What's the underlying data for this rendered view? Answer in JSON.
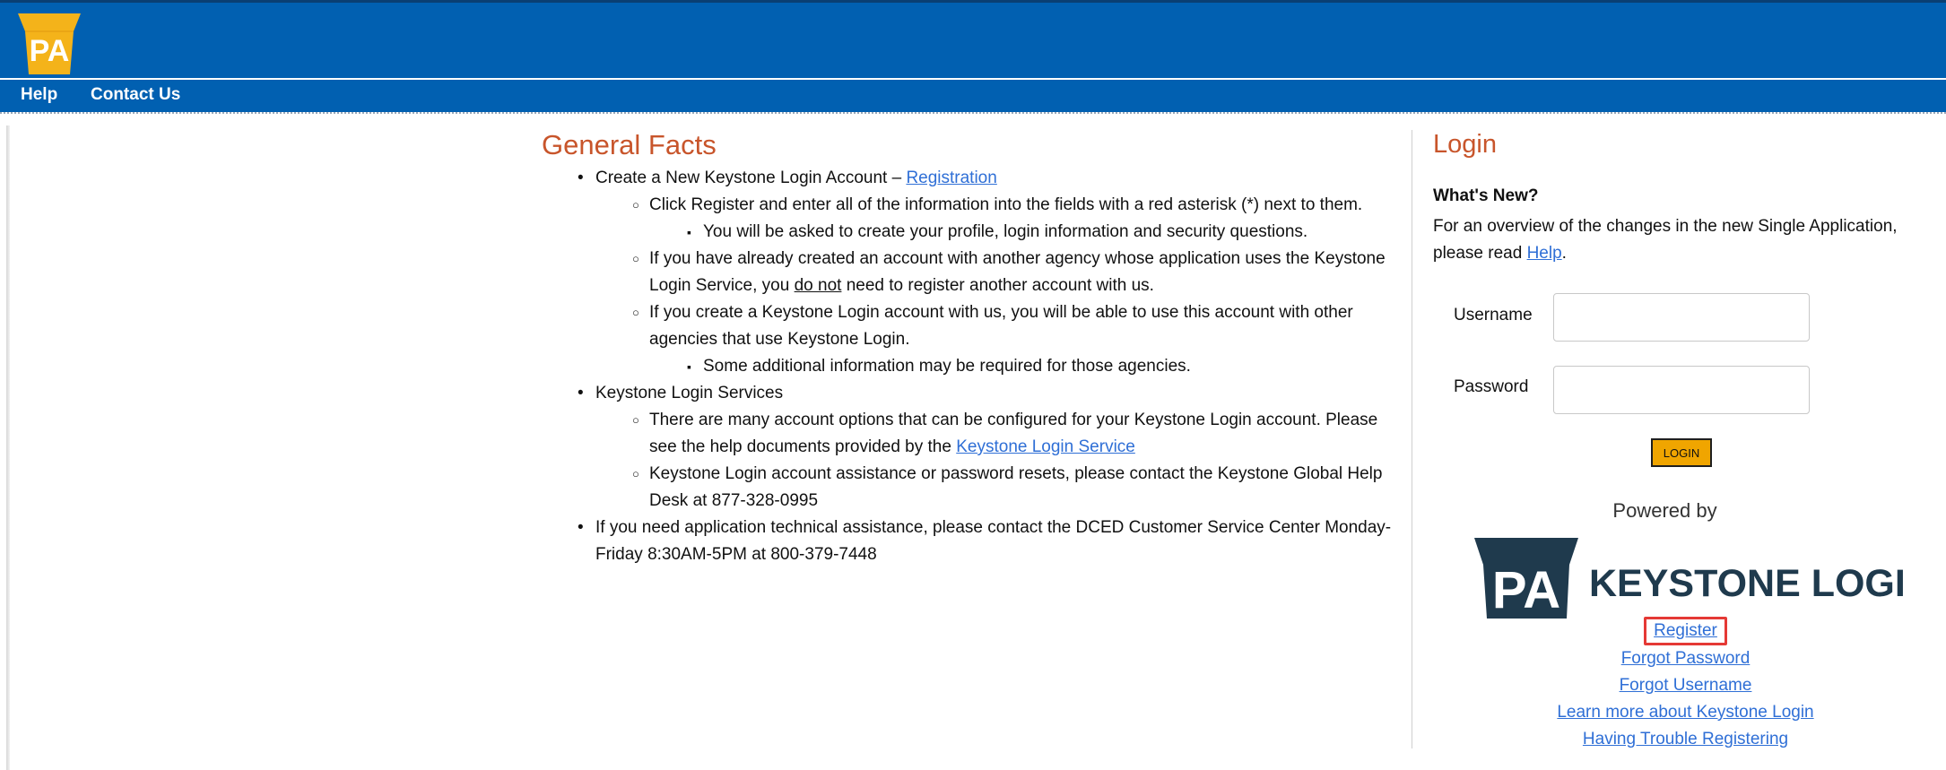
{
  "header": {
    "logo_text": "PA",
    "colors": {
      "bar": "#0160b1",
      "logo_keystone": "#f4b31a"
    }
  },
  "nav": {
    "items": [
      {
        "label": "Help"
      },
      {
        "label": "Contact Us"
      }
    ]
  },
  "general_facts": {
    "title": "General Facts",
    "items": [
      {
        "text": "Create a New Keystone Login Account – ",
        "link": "Registration",
        "children": [
          {
            "text": "Click Register and enter all of the information into the fields with a red asterisk (*) next to them.",
            "children": [
              "You will be asked to create your profile, login information and security questions."
            ]
          },
          {
            "text_before": "If you have already created an account with another agency whose application uses the Keystone Login Service, you ",
            "emphasis": "do not",
            "text_after": " need to register another account with us."
          },
          {
            "text": "If you create a Keystone Login account with us, you will be able to use this account with other agencies that use Keystone Login.",
            "children": [
              "Some additional information may be required for those agencies."
            ]
          }
        ]
      },
      {
        "text": "Keystone Login Services",
        "children": [
          {
            "text": "There are many account options that can be configured for your Keystone Login account. Please see the help documents provided by the ",
            "link": "Keystone Login Service"
          },
          {
            "text": "Keystone Login account assistance or password resets, please contact the Keystone Global Help Desk at 877-328-0995"
          }
        ]
      },
      {
        "text": "If you need application technical assistance, please contact the DCED Customer Service Center Monday-Friday 8:30AM-5PM at 800-379-7448"
      }
    ]
  },
  "login": {
    "title": "Login",
    "whats_new": "What's New?",
    "overview_text": "For an overview of the changes in the new Single Application, please read ",
    "overview_link": "Help",
    "overview_end": ".",
    "username_label": "Username",
    "password_label": "Password",
    "username_value": "",
    "password_value": "",
    "button": "LOGIN",
    "powered_by": "Powered by",
    "keystone_logo_text": "KEYSTONE LOGIN",
    "keystone_logo_pa": "PA",
    "links": [
      {
        "label": "Register",
        "highlighted": true
      },
      {
        "label": "Forgot Password"
      },
      {
        "label": "Forgot Username"
      },
      {
        "label": "Learn more about Keystone Login"
      },
      {
        "label": "Having Trouble Registering"
      }
    ]
  }
}
